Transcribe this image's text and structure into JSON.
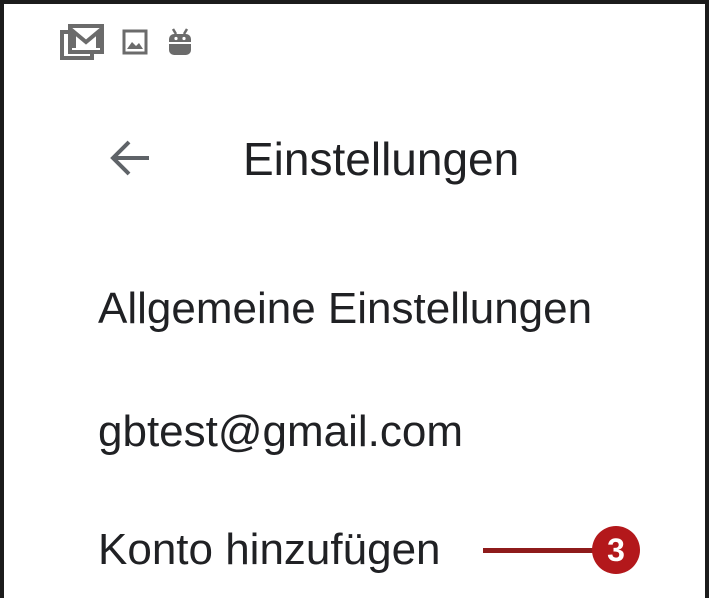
{
  "status_bar": {
    "icons": [
      "gmail-notification-icon",
      "image-notification-icon",
      "android-debug-icon"
    ]
  },
  "app_bar": {
    "back_icon": "arrow-back-icon",
    "title": "Einstellungen"
  },
  "settings_list": [
    {
      "id": "general",
      "label": "Allgemeine Einstellungen"
    },
    {
      "id": "account",
      "label": "gbtest@gmail.com"
    },
    {
      "id": "add",
      "label": "Konto hinzufügen"
    }
  ],
  "callout": {
    "number": "3",
    "color": "#b3181b"
  }
}
